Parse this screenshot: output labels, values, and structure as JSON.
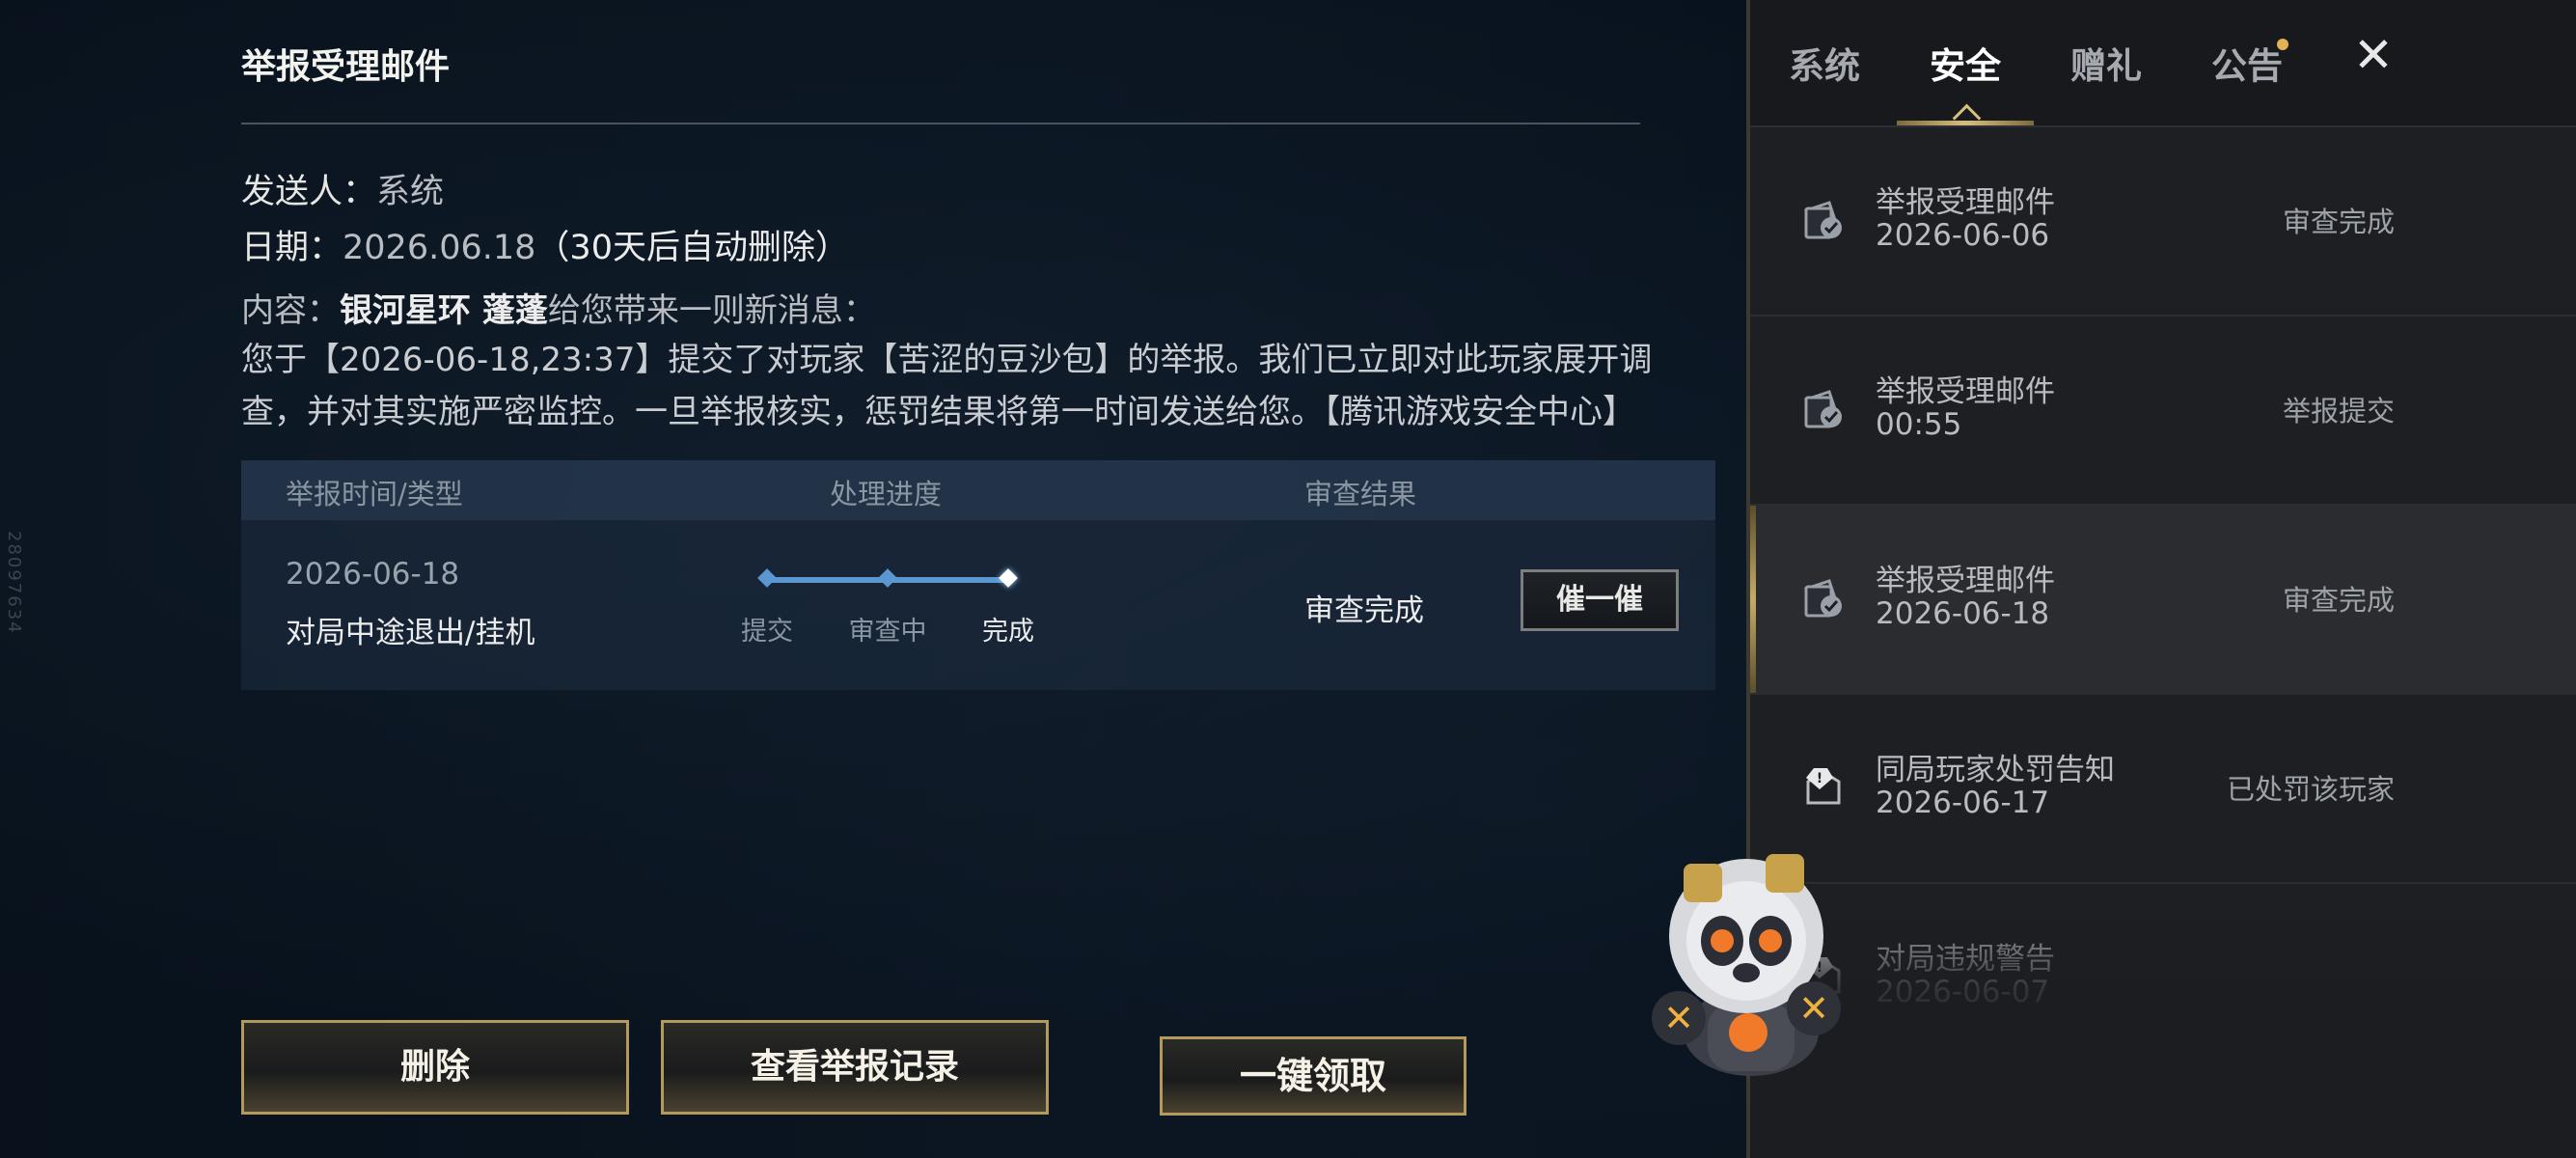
{
  "detail": {
    "title": "举报受理邮件",
    "sender_label": "发送人：",
    "sender_value": "系统",
    "date_label": "日期：",
    "date_value": "2026.06.18",
    "date_note": "（30天后自动删除）",
    "content_label": "内容：",
    "content_source": "银河星环 蓬蓬",
    "content_intro": "给您带来一则新消息：",
    "content_body": "您于【2026-06-18,23:37】提交了对玩家【苦涩的豆沙包】的举报。我们已立即对此玩家展开调查，并对其实施严密监控。一旦举报核实，惩罚结果将第一时间发送给您。【腾讯游戏安全中心】",
    "side_id": "28097634"
  },
  "progress_table": {
    "headers": [
      "举报时间/类型",
      "处理进度",
      "审查结果"
    ],
    "date": "2026-06-18",
    "type": "对局中途退出/挂机",
    "steps": [
      "提交",
      "审查中",
      "完成"
    ],
    "progress_fraction": 1.0,
    "track_color": "#5b97d0",
    "result": "审查完成",
    "urge_button": "催一催"
  },
  "actions": {
    "delete": "删除",
    "view_records": "查看举报记录"
  },
  "tabs": {
    "items": [
      "系统",
      "安全",
      "赠礼",
      "公告"
    ],
    "active": "安全",
    "close_icon": "close-icon"
  },
  "mail_list": [
    {
      "title": "举报受理邮件",
      "date": "2026-06-06",
      "status": "审查完成",
      "icon": "mail-check-icon"
    },
    {
      "title": "举报受理邮件",
      "date": "00:55",
      "status": "举报提交",
      "icon": "mail-check-icon"
    },
    {
      "title": "举报受理邮件",
      "date": "2026-06-18",
      "status": "审查完成",
      "icon": "mail-check-icon"
    },
    {
      "title": "同局玩家处罚告知",
      "date": "2026-06-17",
      "status": "已处罚该玩家",
      "icon": "mail-alert-icon"
    },
    {
      "title": "对局违规警告",
      "date": "2026-06-07",
      "status": "",
      "icon": "mail-alert-icon"
    }
  ],
  "claim_all": "一键领取",
  "colors": {
    "accent_gold": "#c6ac66",
    "progress_blue": "#5b97d0"
  }
}
